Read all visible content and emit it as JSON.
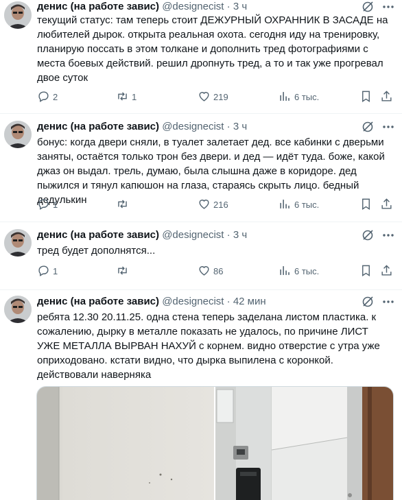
{
  "tweets": [
    {
      "author": "денис (на работе завис)",
      "handle": "@designecist",
      "separator": "·",
      "time": "3 ч",
      "text": "текущий статус: там теперь стоит ДЕЖУРНЫЙ ОХРАННИК В ЗАСАДЕ на любителей дырок. открыта реальная охота. сегодня иду на тренировку, планирую поссать в этом толкане и дополнить тред фотографиями с места боевых действий. решил дропнуть тред, а то и так уже прогревал двое суток",
      "replies": "2",
      "retweets": "1",
      "likes": "219",
      "views": "6 тыс."
    },
    {
      "author": "денис (на работе завис)",
      "handle": "@designecist",
      "separator": "·",
      "time": "3 ч",
      "text": "бонус: когда двери сняли, в туалет залетает дед. все кабинки с дверьми заняты, остаётся только трон без двери. и дед — идёт туда. боже, какой джаз он выдал. трель, думаю, была слышна даже в коридоре. дед пыжился и тянул капюшон на глаза, стараясь скрыть лицо. бедный дедулькин",
      "replies": "1",
      "retweets": "",
      "likes": "216",
      "views": "6 тыс."
    },
    {
      "author": "денис (на работе завис)",
      "handle": "@designecist",
      "separator": "·",
      "time": "3 ч",
      "text": "тред будет дополнятся...",
      "replies": "1",
      "retweets": "",
      "likes": "86",
      "views": "6 тыс."
    },
    {
      "author": "денис (на работе завис)",
      "handle": "@designecist",
      "separator": "·",
      "time": "42 мин",
      "text": "ребята 12.30 20.11.25. одна стена теперь заделана листом пластика. к сожалению, дырку в металле показать не удалось, по причине ЛИСТ УЖЕ МЕТАЛЛА ВЫРВАН НАХУЙ с корнем. видно отверстие с утра уже оприходовано. кстати видно, что дырка выпилена с коронкой. действовали наверняка"
    }
  ],
  "icons": {
    "reply": "reply-icon",
    "retweet": "retweet-icon",
    "like": "heart-icon",
    "views": "views-icon",
    "bookmark": "bookmark-icon",
    "share": "share-icon",
    "grok": "grok-icon",
    "more": "more-icon"
  },
  "colors": {
    "text": "#0f1419",
    "secondary": "#536471",
    "divider": "#eff3f4"
  }
}
